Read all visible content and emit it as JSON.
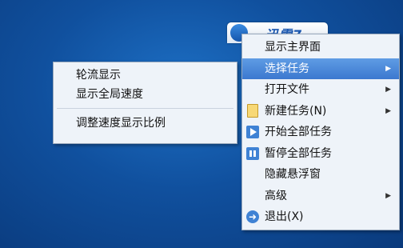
{
  "widget": {
    "title": "迅雷7"
  },
  "submenu": {
    "items": [
      {
        "label": "轮流显示"
      },
      {
        "label": "显示全局速度"
      },
      {
        "label": "调整速度显示比例"
      }
    ]
  },
  "menu": {
    "items": [
      {
        "label": "显示主界面"
      },
      {
        "label": "选择任务",
        "arrow": "▶"
      },
      {
        "label": "打开文件",
        "arrow": "▶"
      },
      {
        "label": "新建任务(N)",
        "arrow": "▶"
      },
      {
        "label": "开始全部任务"
      },
      {
        "label": "暂停全部任务"
      },
      {
        "label": "隐藏悬浮窗"
      },
      {
        "label": "高级",
        "arrow": "▶"
      },
      {
        "label": "退出(X)"
      }
    ]
  }
}
